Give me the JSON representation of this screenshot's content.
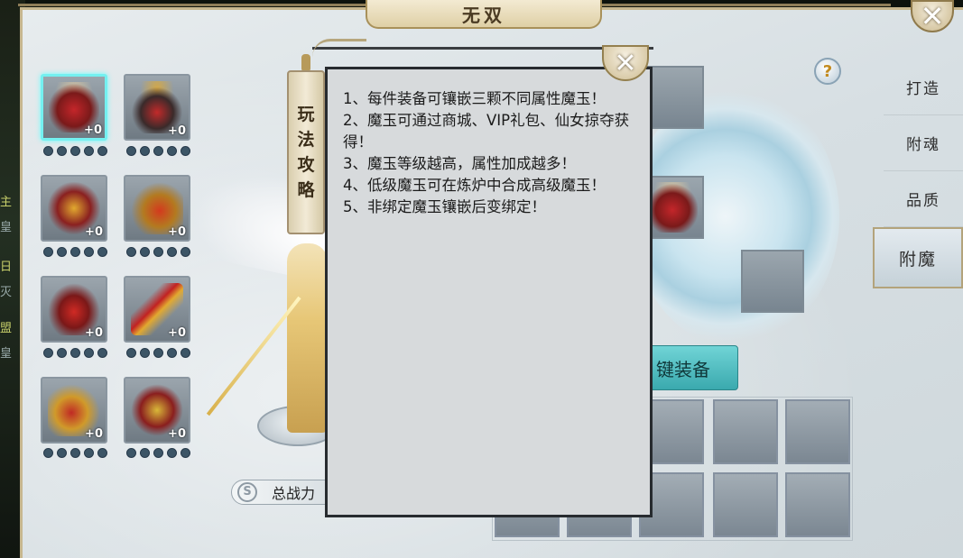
{
  "window": {
    "title": "无双",
    "close_icon": "close-icon"
  },
  "side_fragments": [
    "主",
    "皇",
    "日",
    "灭",
    "盟",
    "皇"
  ],
  "tabs": [
    {
      "label": "打造",
      "active": false
    },
    {
      "label": "附魂",
      "active": false
    },
    {
      "label": "品质",
      "active": false
    },
    {
      "label": "附魔",
      "active": true
    }
  ],
  "help": {
    "symbol": "?"
  },
  "equipment": [
    {
      "name": "helmet",
      "level": "+0",
      "selected": true
    },
    {
      "name": "necklace",
      "level": "+0",
      "selected": false
    },
    {
      "name": "armor",
      "level": "+0",
      "selected": false
    },
    {
      "name": "ring",
      "level": "+0",
      "selected": false
    },
    {
      "name": "belt",
      "level": "+0",
      "selected": false
    },
    {
      "name": "weapon",
      "level": "+0",
      "selected": false
    },
    {
      "name": "boots",
      "level": "+0",
      "selected": false
    },
    {
      "name": "talisman",
      "level": "+0",
      "selected": false
    }
  ],
  "power": {
    "label": "总战力"
  },
  "equip_button": {
    "label": "键装备"
  },
  "guide": {
    "tab_label": [
      "玩",
      "法",
      "攻",
      "略"
    ],
    "lines": [
      "1、每件装备可镶嵌三颗不同属性魔玉！",
      "2、魔玉可通过商城、VIP礼包、仙女掠夺获得！",
      "3、魔玉等级越高，属性加成越多！",
      "4、低级魔玉可在炼炉中合成高级魔玉！",
      "5、非绑定魔玉镶嵌后变绑定！"
    ]
  }
}
